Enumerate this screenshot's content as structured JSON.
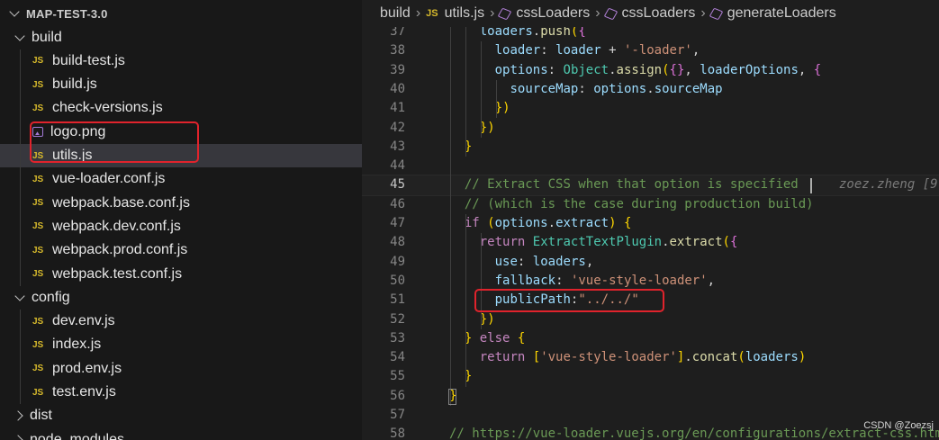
{
  "explorer": {
    "root_label": "MAP-TEST-3.0",
    "folders": {
      "build": "build",
      "config": "config",
      "dist": "dist",
      "node_modules": "node_modules"
    },
    "build_files": [
      "build-test.js",
      "build.js",
      "check-versions.js",
      "logo.png",
      "utils.js",
      "vue-loader.conf.js",
      "webpack.base.conf.js",
      "webpack.dev.conf.js",
      "webpack.prod.conf.js",
      "webpack.test.conf.js"
    ],
    "config_files": [
      "dev.env.js",
      "index.js",
      "prod.env.js",
      "test.env.js"
    ],
    "selected_file": "utils.js",
    "js_icon_text": "JS"
  },
  "breadcrumb": {
    "items": [
      "build",
      "utils.js",
      "cssLoaders",
      "cssLoaders",
      "generateLoaders"
    ],
    "separator": "›"
  },
  "editor": {
    "current_line": 45,
    "lines": [
      {
        "n": "37",
        "t": "    loaders.push({"
      },
      {
        "n": "38",
        "t": "      loader: loader + '-loader',"
      },
      {
        "n": "39",
        "t": "      options: Object.assign({}, loaderOptions, {"
      },
      {
        "n": "40",
        "t": "        sourceMap: options.sourceMap"
      },
      {
        "n": "41",
        "t": "      })"
      },
      {
        "n": "42",
        "t": "    })"
      },
      {
        "n": "43",
        "t": "  }"
      },
      {
        "n": "44",
        "t": ""
      },
      {
        "n": "45",
        "t": "  // Extract CSS when that option is specified"
      },
      {
        "n": "46",
        "t": "  // (which is the case during production build)"
      },
      {
        "n": "47",
        "t": "  if (options.extract) {"
      },
      {
        "n": "48",
        "t": "    return ExtractTextPlugin.extract({"
      },
      {
        "n": "49",
        "t": "      use: loaders,"
      },
      {
        "n": "50",
        "t": "      fallback: 'vue-style-loader',"
      },
      {
        "n": "51",
        "t": "      publicPath:\"../../\""
      },
      {
        "n": "52",
        "t": "    })"
      },
      {
        "n": "53",
        "t": "  } else {"
      },
      {
        "n": "54",
        "t": "    return ['vue-style-loader'].concat(loaders)"
      },
      {
        "n": "55",
        "t": "  }"
      },
      {
        "n": "56",
        "t": "}"
      },
      {
        "n": "57",
        "t": ""
      },
      {
        "n": "58",
        "t": "// https://vue-loader.vuejs.org/en/configurations/extract-css.html"
      }
    ],
    "blame_text": "zoez.zheng [9"
  },
  "watermark": "CSDN @Zoezsj",
  "colors": {
    "highlight_box": "#e0232c",
    "selected_row": "#37373d",
    "js_icon": "#d7ba2c"
  },
  "icons": {
    "folder_chevron": "chevron-icon",
    "file": "js-file-icon",
    "image_file": "image-file-icon",
    "symbol": "method-cube-icon"
  }
}
